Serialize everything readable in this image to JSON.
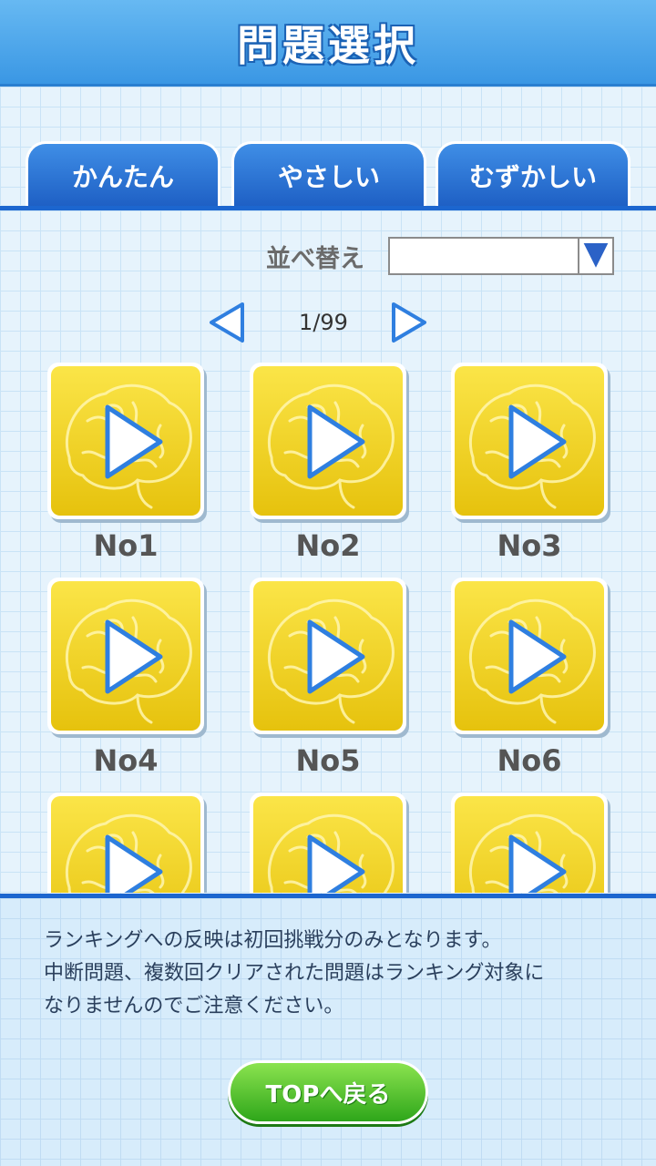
{
  "header": {
    "title": "問題選択"
  },
  "tabs": [
    {
      "label": "かんたん"
    },
    {
      "label": "やさしい"
    },
    {
      "label": "むずかしい"
    }
  ],
  "sort": {
    "label": "並べ替え",
    "value": ""
  },
  "pager": {
    "text": "1/99"
  },
  "items": [
    {
      "label": "No1"
    },
    {
      "label": "No2"
    },
    {
      "label": "No3"
    },
    {
      "label": "No4"
    },
    {
      "label": "No5"
    },
    {
      "label": "No6"
    },
    {
      "label": ""
    },
    {
      "label": ""
    },
    {
      "label": ""
    }
  ],
  "notice": {
    "line1": "ランキングへの反映は初回挑戦分のみとなります。",
    "line2": "中断問題、複数回クリアされた問題はランキング対象に",
    "line3": "なりませんのでご注意ください。"
  },
  "footer": {
    "top_button": "TOPへ戻る"
  },
  "colors": {
    "accent_blue": "#1c66cf",
    "item_yellow": "#f3d21f",
    "play_blue": "#2f7fe0",
    "button_green": "#3fb82a"
  },
  "icons": {
    "item": "brain-play-icon",
    "prev": "arrow-left-icon",
    "next": "arrow-right-icon",
    "dropdown": "triangle-down-icon"
  }
}
